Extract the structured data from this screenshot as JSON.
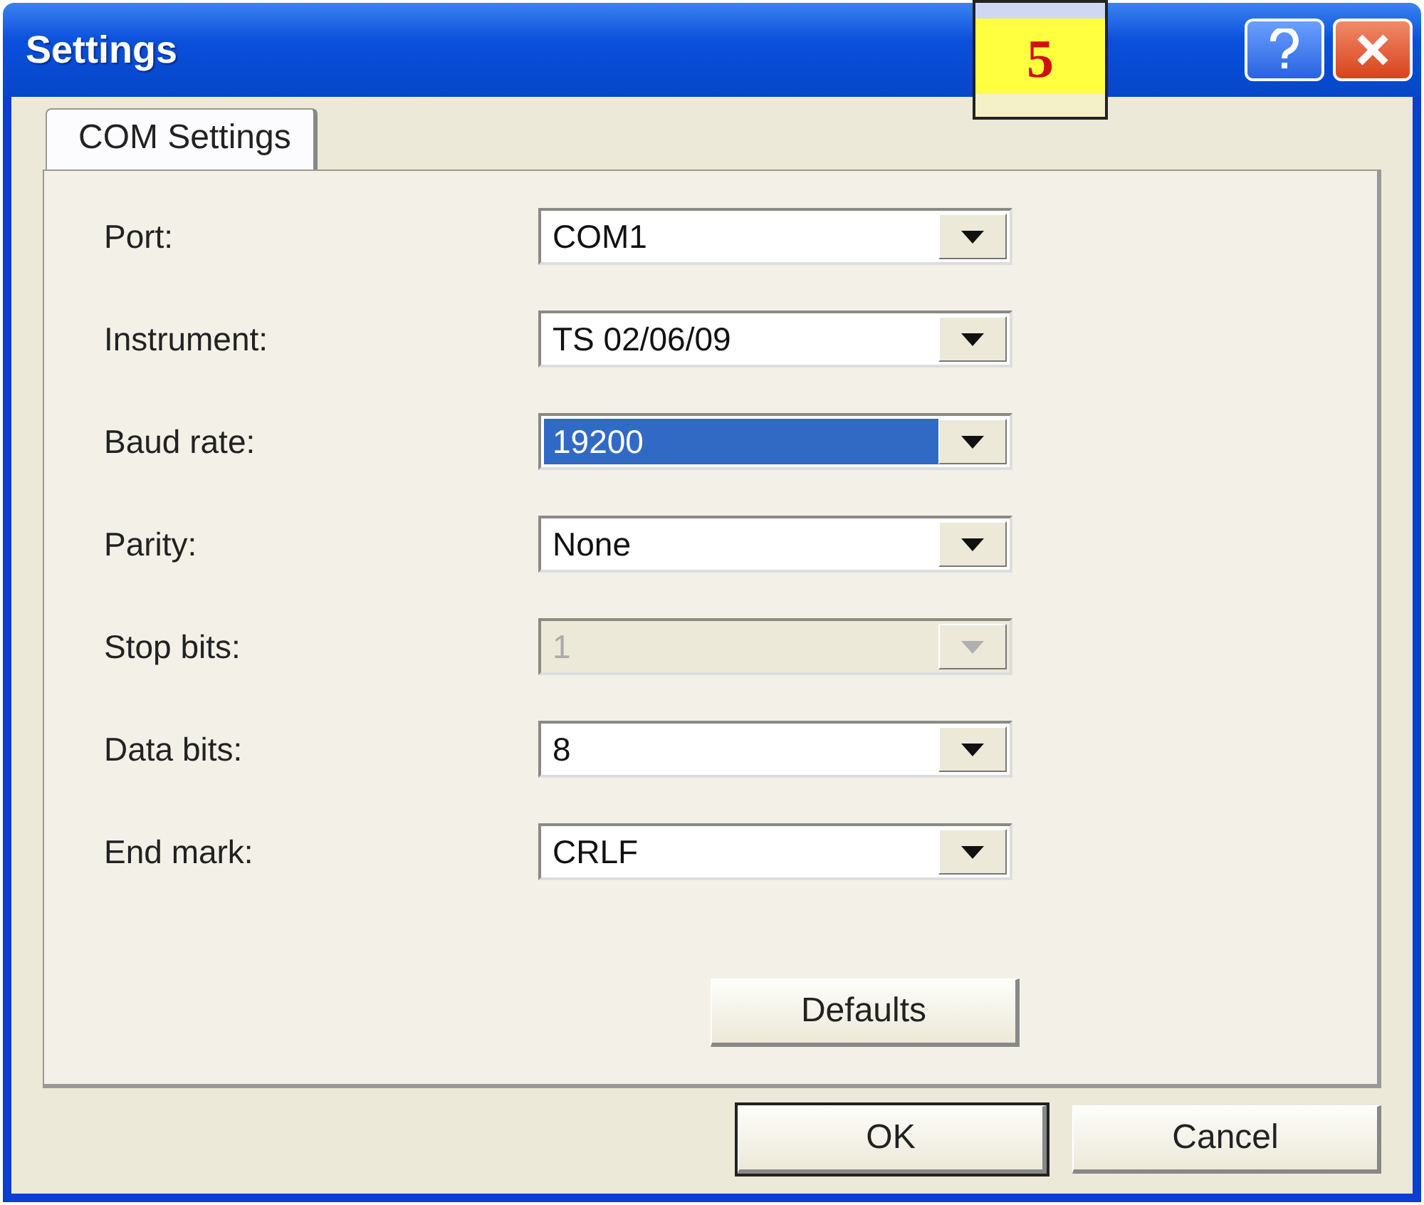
{
  "window": {
    "title": "Settings"
  },
  "annotation": {
    "label": "5"
  },
  "tabs": [
    {
      "label": "COM Settings",
      "selected": true
    }
  ],
  "fields": [
    {
      "label": "Port:",
      "value": "COM1",
      "selected": false,
      "disabled": false
    },
    {
      "label": "Instrument:",
      "value": "TS 02/06/09",
      "selected": false,
      "disabled": false
    },
    {
      "label": "Baud rate:",
      "value": "19200",
      "selected": true,
      "disabled": false
    },
    {
      "label": "Parity:",
      "value": "None",
      "selected": false,
      "disabled": false
    },
    {
      "label": "Stop bits:",
      "value": "1",
      "selected": false,
      "disabled": true
    },
    {
      "label": "Data bits:",
      "value": "8",
      "selected": false,
      "disabled": false
    },
    {
      "label": "End mark:",
      "value": "CRLF",
      "selected": false,
      "disabled": false
    }
  ],
  "panel_button": {
    "label": "Defaults"
  },
  "buttons": [
    {
      "label": "OK",
      "default": true
    },
    {
      "label": "Cancel",
      "default": false
    }
  ]
}
